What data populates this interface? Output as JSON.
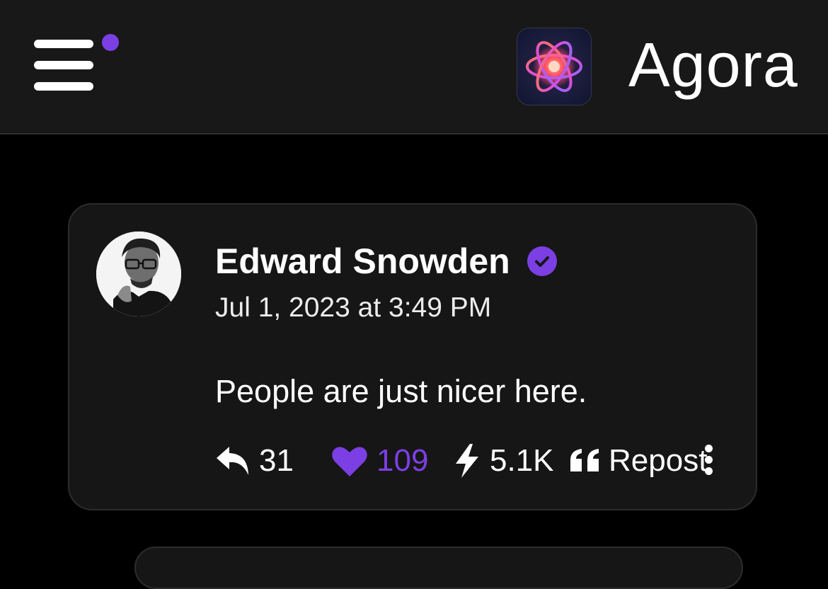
{
  "app": {
    "title": "Agora",
    "accent_color": "#7b3fe4",
    "logo_icon": "atom-icon"
  },
  "header": {
    "menu_icon": "hamburger-menu-icon",
    "has_notification_dot": true
  },
  "post": {
    "author": {
      "name": "Edward Snowden",
      "verified": true,
      "avatar_icon": "avatar"
    },
    "timestamp": "Jul 1, 2023 at 3:49 PM",
    "text": "People are just nicer here.",
    "actions": {
      "replies": {
        "icon": "reply-icon",
        "count": "31"
      },
      "likes": {
        "icon": "heart-icon",
        "count": "109",
        "liked": true
      },
      "zaps": {
        "icon": "lightning-icon",
        "count": "5.1K"
      },
      "repost": {
        "icon": "quote-icon",
        "label": "Repost"
      },
      "more_icon": "more-vertical-icon"
    }
  }
}
